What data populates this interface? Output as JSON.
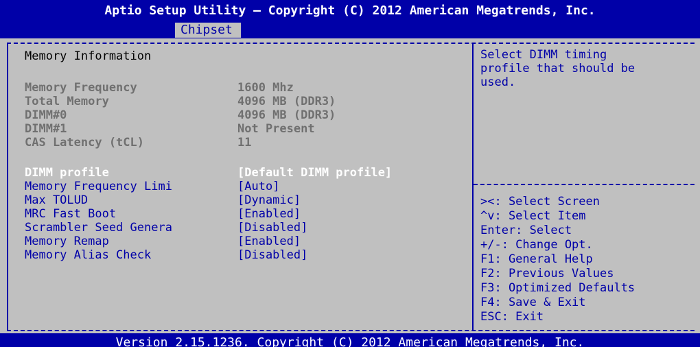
{
  "header": {
    "title": "Aptio Setup Utility – Copyright (C) 2012 American Megatrends, Inc.",
    "active_tab": "Chipset"
  },
  "main": {
    "section_title": "Memory Information",
    "info": [
      {
        "label": "Memory Frequency",
        "value": "1600 Mhz"
      },
      {
        "label": "Total Memory",
        "value": "4096 MB (DDR3)"
      },
      {
        "label": "DIMM#0",
        "value": "4096 MB (DDR3)"
      },
      {
        "label": "DIMM#1",
        "value": "Not Present"
      },
      {
        "label": "CAS Latency (tCL)",
        "value": "11"
      }
    ],
    "options": [
      {
        "label": "DIMM profile",
        "value": "[Default DIMM profile]",
        "selected": true
      },
      {
        "label": "Memory Frequency Limi",
        "value": "[Auto]"
      },
      {
        "label": "Max TOLUD",
        "value": "[Dynamic]"
      },
      {
        "label": "MRC Fast Boot",
        "value": "[Enabled]"
      },
      {
        "label": "Scrambler Seed Genera",
        "value": "[Disabled]"
      },
      {
        "label": "Memory Remap",
        "value": "[Enabled]"
      },
      {
        "label": "Memory Alias Check",
        "value": "[Disabled]"
      }
    ]
  },
  "help": {
    "text": "Select DIMM timing\nprofile that should be\nused."
  },
  "keys": [
    "><: Select Screen",
    "^v: Select Item",
    "Enter: Select",
    "+/-: Change Opt.",
    "F1: General Help",
    "F2: Previous Values",
    "F3: Optimized Defaults",
    "F4: Save & Exit",
    "ESC: Exit"
  ],
  "footer": {
    "text": "Version 2.15.1236. Copyright (C) 2012 American Megatrends, Inc."
  },
  "colors": {
    "bios_blue": "#0000a8",
    "background_gray": "#c0c0c0",
    "disabled_gray": "#707070",
    "highlight_white": "#ffffff"
  }
}
